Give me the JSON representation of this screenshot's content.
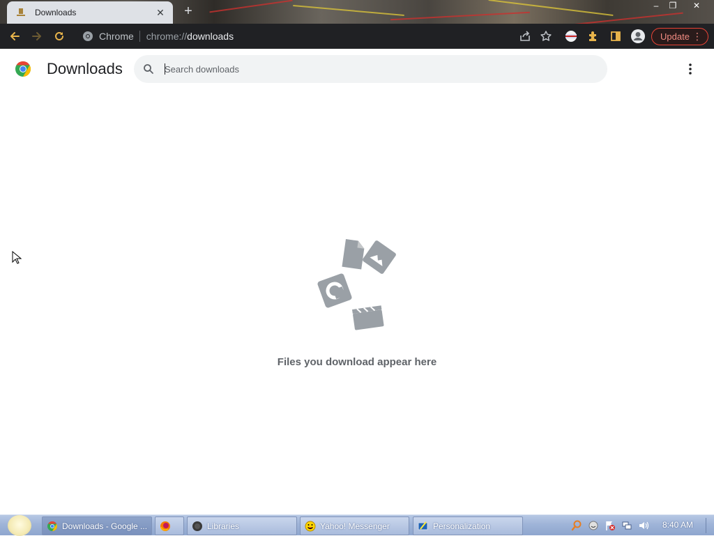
{
  "tab": {
    "title": "Downloads",
    "close_label": "✕",
    "new_tab_label": "+"
  },
  "window_controls": {
    "minimize": "–",
    "maximize": "❐",
    "close": "✕"
  },
  "toolbar": {
    "back_icon": "back-arrow-icon",
    "forward_icon": "forward-arrow-icon",
    "reload_icon": "reload-icon"
  },
  "omnibox": {
    "site_label": "Chrome",
    "url_scheme": "chrome://",
    "url_host": "downloads"
  },
  "update_button": {
    "label": "Update",
    "menu": "⋮"
  },
  "page": {
    "title": "Downloads",
    "search_placeholder": "Search downloads",
    "empty_message": "Files you download appear here",
    "menu": "⋮"
  },
  "taskbar": {
    "items": [
      {
        "label": "Downloads - Google ...",
        "icon": "chrome-icon",
        "active": true
      },
      {
        "label": "",
        "icon": "firefox-icon",
        "active": false
      },
      {
        "label": "Libraries",
        "icon": "libraries-icon",
        "active": false
      },
      {
        "label": "Yahoo! Messenger",
        "icon": "yahoo-messenger-icon",
        "active": false
      },
      {
        "label": "Personalization",
        "icon": "personalization-icon",
        "active": false
      }
    ],
    "clock": "8:40 AM"
  },
  "colors": {
    "toolbar_bg": "#202124",
    "tab_bg": "#dee1e6",
    "accent_red": "#e94235",
    "empty_icon": "#9aa0a6"
  }
}
